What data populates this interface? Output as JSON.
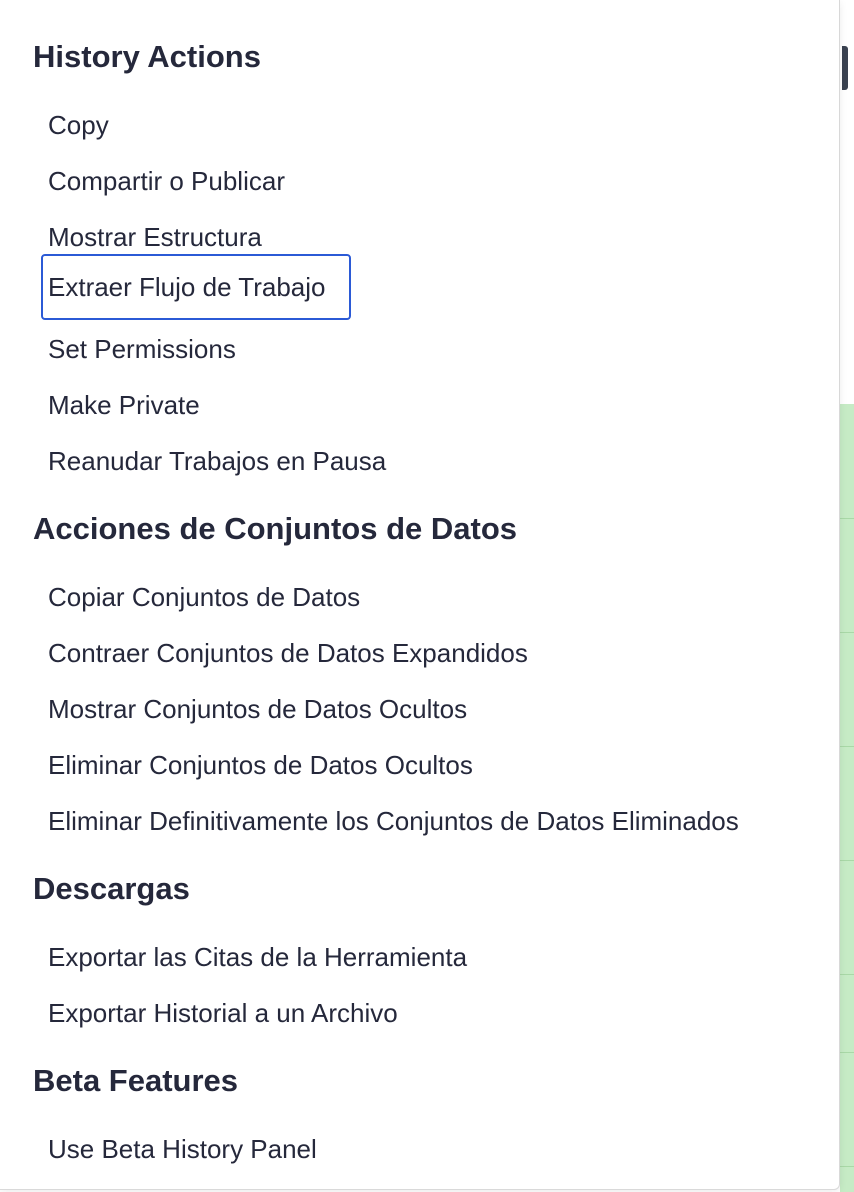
{
  "menu": {
    "sections": [
      {
        "title": "History Actions",
        "items": [
          "Copy",
          "Compartir o Publicar",
          "Mostrar Estructura",
          "Extraer Flujo de Trabajo",
          "Set Permissions",
          "Make Private",
          "Reanudar Trabajos en Pausa"
        ]
      },
      {
        "title": "Acciones de Conjuntos de Datos",
        "items": [
          "Copiar Conjuntos de Datos",
          "Contraer Conjuntos de Datos Expandidos",
          "Mostrar Conjuntos de Datos Ocultos",
          "Eliminar Conjuntos de Datos Ocultos",
          "Eliminar Definitivamente los Conjuntos de Datos Eliminados"
        ]
      },
      {
        "title": "Descargas",
        "items": [
          "Exportar las Citas de la Herramienta",
          "Exportar Historial a un Archivo"
        ]
      },
      {
        "title": "Beta Features",
        "items": [
          "Use Beta History Panel"
        ]
      }
    ],
    "focused_item": "Extraer Flujo de Trabajo"
  },
  "colors": {
    "text": "#25283b",
    "focus_outline": "#2b5ad6",
    "background_green": "#c6ebc5"
  }
}
